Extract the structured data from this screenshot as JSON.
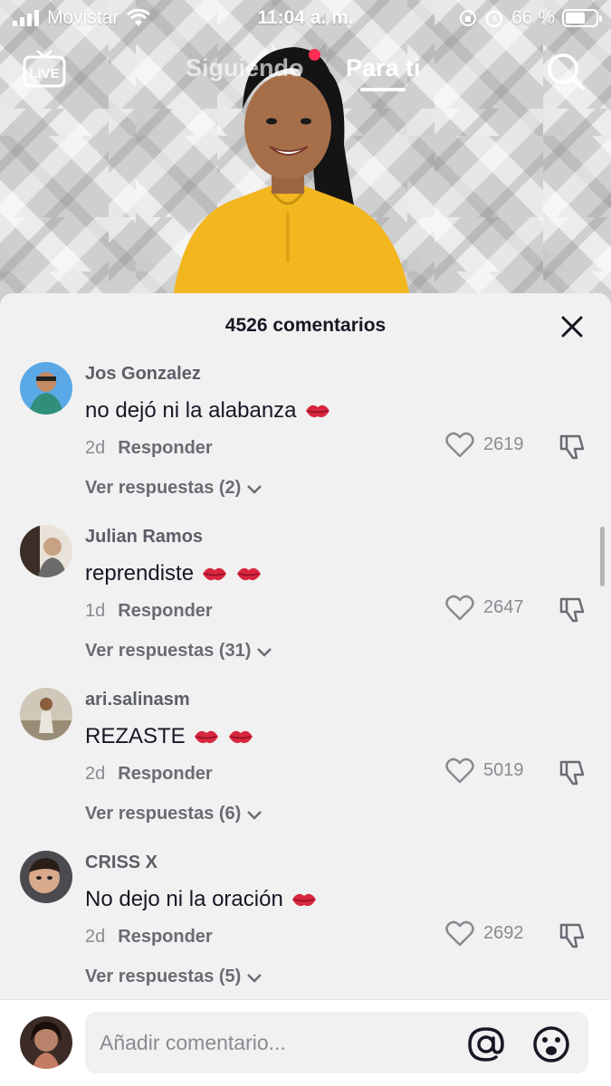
{
  "status_bar": {
    "carrier": "Movistar",
    "time": "11:04 a. m.",
    "battery_text": "66 %",
    "battery_level": 0.66
  },
  "nav": {
    "live_label": "LIVE",
    "tabs": [
      {
        "label": "Siguiendo",
        "active": false
      },
      {
        "label": "Para ti",
        "active": true
      }
    ]
  },
  "sheet": {
    "comment_count": "4526 comentarios"
  },
  "comments": [
    {
      "username": "Jos Gonzalez",
      "text": "no dejó ni la alabanza",
      "emojis": 1,
      "age": "2d",
      "reply_label": "Responder",
      "likes": "2619",
      "view_replies": "Ver respuestas (2)"
    },
    {
      "username": "Julian Ramos",
      "text": "reprendiste",
      "emojis": 2,
      "age": "1d",
      "reply_label": "Responder",
      "likes": "2647",
      "view_replies": "Ver respuestas (31)"
    },
    {
      "username": "ari.salinasm",
      "text": "REZASTE",
      "emojis": 2,
      "age": "2d",
      "reply_label": "Responder",
      "likes": "5019",
      "view_replies": "Ver respuestas (6)"
    },
    {
      "username": "CRISS X",
      "text": "No dejo ni la oración",
      "emojis": 1,
      "age": "2d",
      "reply_label": "Responder",
      "likes": "2692",
      "view_replies": "Ver respuestas (5)"
    }
  ],
  "input": {
    "placeholder": "Añadir comentario..."
  },
  "colors": {
    "accent_red": "#fe2c55",
    "shirt_yellow": "#f2b61f",
    "text_primary": "#161823",
    "text_secondary": "#8a8b91",
    "kiss_red": "#d7263d"
  },
  "icons": [
    "live-icon",
    "search-icon",
    "close-icon",
    "heart-icon",
    "dislike-icon",
    "chevron-down-icon",
    "kiss-mark-icon",
    "at-icon",
    "emoji-icon"
  ]
}
